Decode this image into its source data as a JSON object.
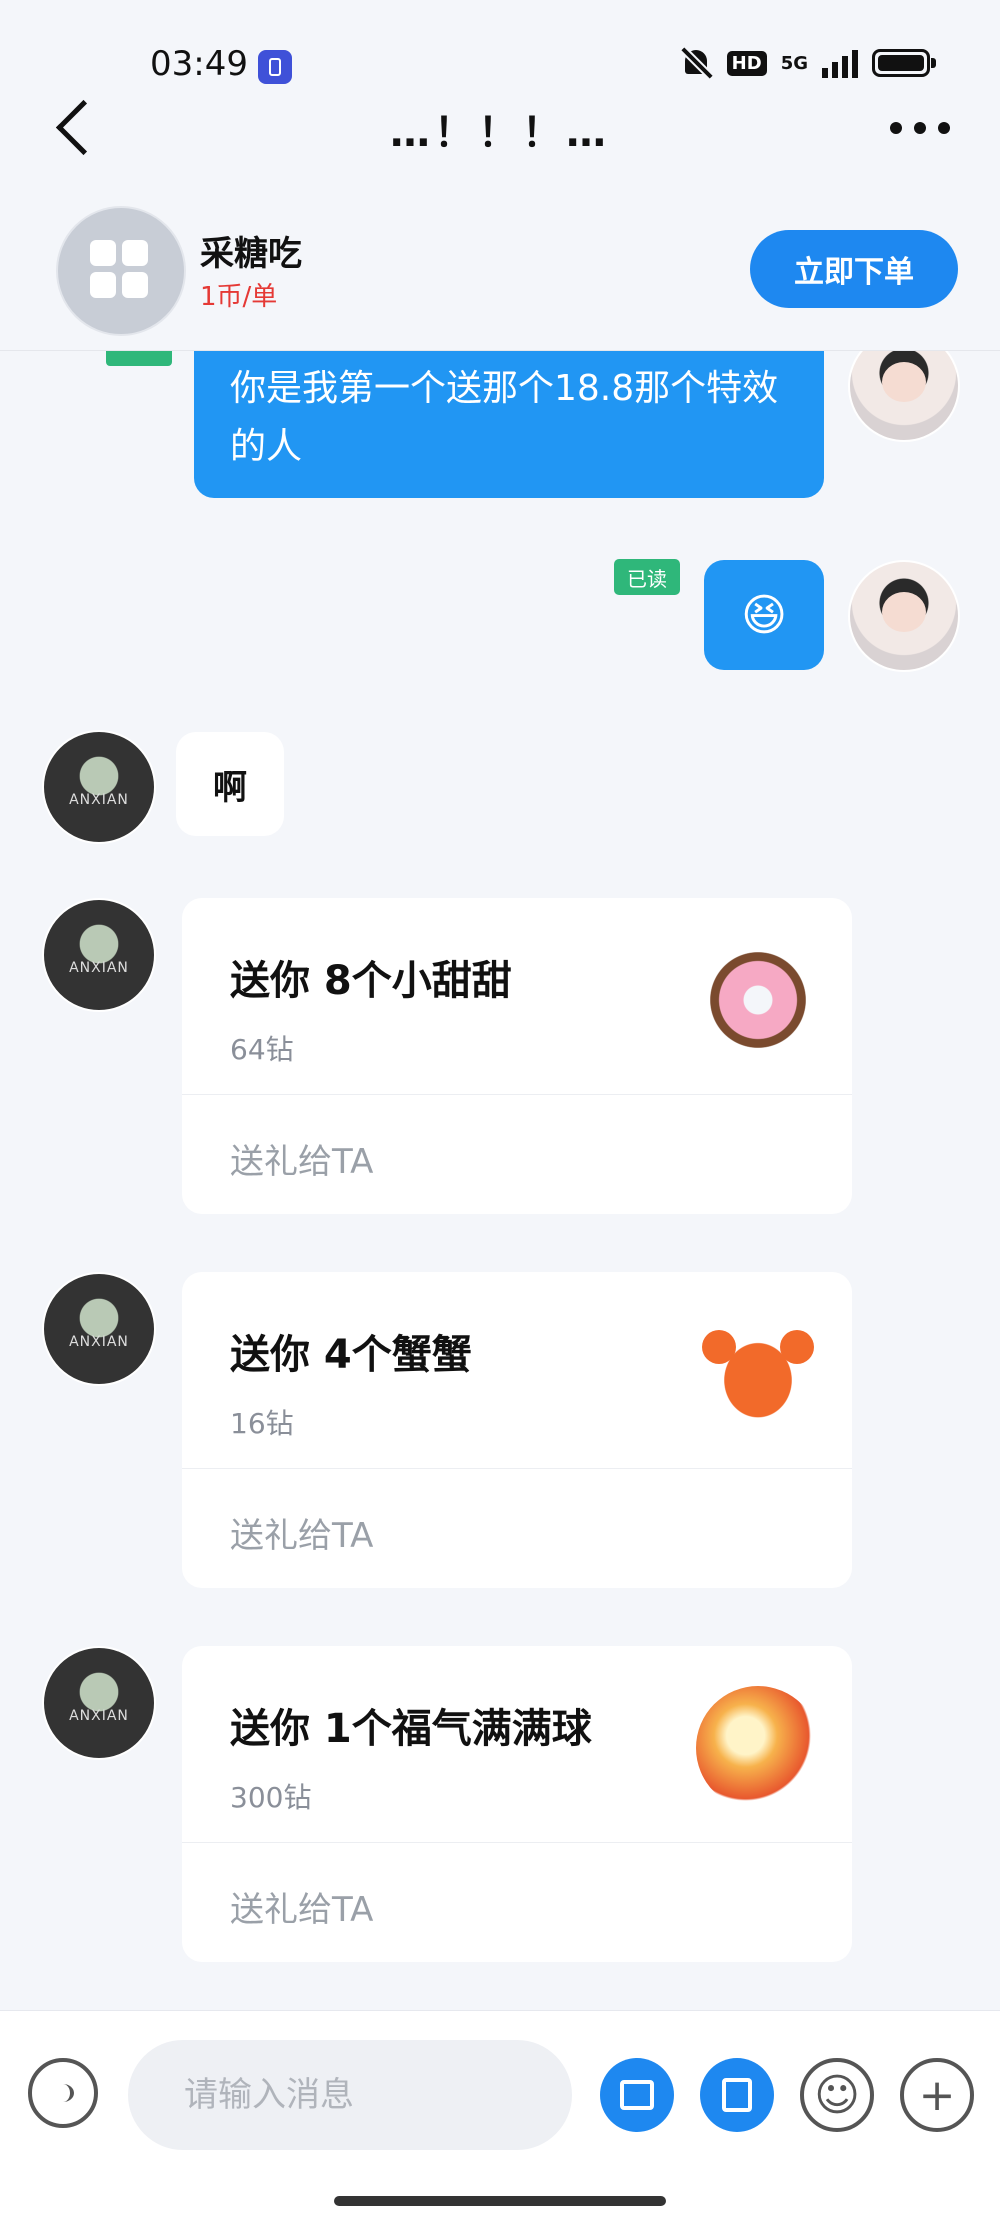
{
  "status_bar": {
    "time": "03:49",
    "hd_label": "HD",
    "network_label": "5G",
    "icons": [
      "app-badge-icon",
      "bell-muted-icon",
      "signal-icon",
      "battery-icon"
    ]
  },
  "nav": {
    "title": "…！！！…",
    "back_icon": "back-chevron-icon",
    "more_icon": "more-dots-icon"
  },
  "host": {
    "name": "采糖吃",
    "price": "1币/单",
    "order_button": "立即下单"
  },
  "messages": [
    {
      "side": "right",
      "type": "text",
      "text": "你是我第一个送那个18.8那个特效的人"
    },
    {
      "side": "right",
      "type": "emoji",
      "text": "😆",
      "read_label": "已读"
    },
    {
      "side": "left",
      "type": "text",
      "text": "啊"
    }
  ],
  "gifts": [
    {
      "title": "送你 8个小甜甜",
      "price": "64钻",
      "action": "送礼给TA",
      "icon": "donut-gift-icon"
    },
    {
      "title": "送你 4个蟹蟹",
      "price": "16钻",
      "action": "送礼给TA",
      "icon": "crab-gift-icon"
    },
    {
      "title": "送你 1个福气满满球",
      "price": "300钻",
      "action": "送礼给TA",
      "icon": "lucky-ball-gift-icon"
    }
  ],
  "avatar_watermark": "ANXIAN",
  "input": {
    "placeholder": "请输入消息"
  },
  "colors": {
    "accent": "#1e88f0",
    "read_badge": "#2fb77a",
    "price_red": "#e53935",
    "background": "#f4f6fa"
  }
}
